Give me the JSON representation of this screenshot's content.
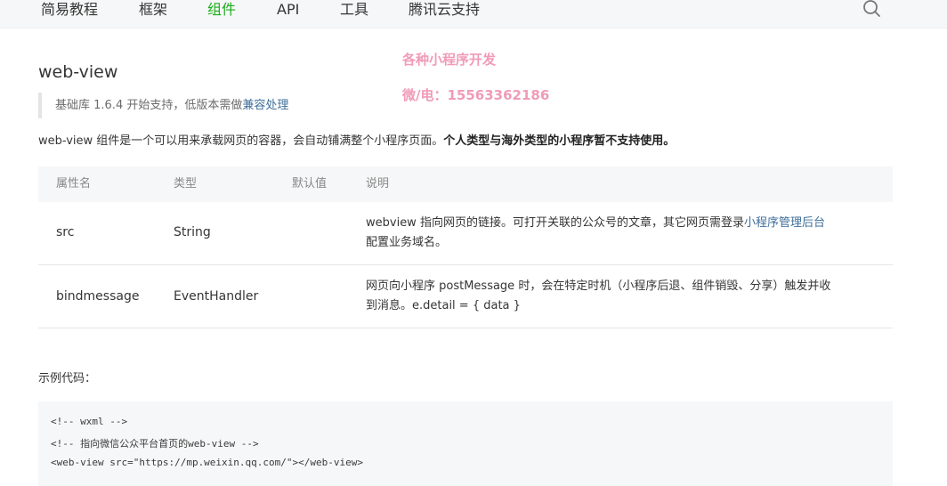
{
  "nav": {
    "items": [
      {
        "label": "简易教程",
        "active": false
      },
      {
        "label": "框架",
        "active": false
      },
      {
        "label": "组件",
        "active": true
      },
      {
        "label": "API",
        "active": false
      },
      {
        "label": "工具",
        "active": false
      },
      {
        "label": "腾讯云支持",
        "active": false
      }
    ],
    "search_icon": "search-icon"
  },
  "watermark": {
    "line1": "各种小程序开发",
    "line2": "微/电：15563362186"
  },
  "page": {
    "title": "web-view",
    "support_note_prefix": "基础库 1.6.4 开始支持，低版本需做",
    "support_note_link": "兼容处理",
    "intro_text": "web-view 组件是一个可以用来承载网页的容器，会自动铺满整个小程序页面。",
    "intro_bold": "个人类型与海外类型的小程序暂不支持使用。"
  },
  "table": {
    "headers": [
      "属性名",
      "类型",
      "默认值",
      "说明"
    ],
    "rows": [
      {
        "name": "src",
        "type": "String",
        "default": "",
        "desc_line1_prefix": "webview 指向网页的链接。可打开关联的公众号的文章，其它网页需登录",
        "desc_line1_link": "小程序管理后台",
        "desc_line2": "配置业务域名。"
      },
      {
        "name": "bindmessage",
        "type": "EventHandler",
        "default": "",
        "desc_line1": "网页向小程序 postMessage 时，会在特定时机（小程序后退、组件销毁、分享）触发并收",
        "desc_line2": "到消息。e.detail = { data }"
      }
    ]
  },
  "example": {
    "label": "示例代码：",
    "lines": [
      "<!-- wxml -->",
      "<!-- 指向微信公众平台首页的web-view -->",
      "<web-view src=\"https://mp.weixin.qq.com/\"></web-view>"
    ]
  },
  "colors": {
    "accent_green": "#1aad19",
    "link_blue": "#3e6e9a",
    "watermark_pink": "#f09bb8"
  }
}
